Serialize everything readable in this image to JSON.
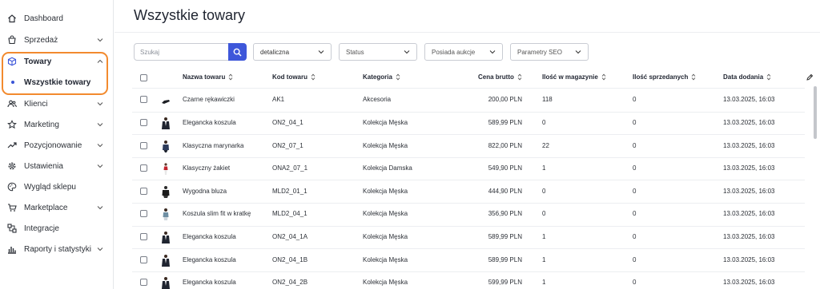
{
  "sidebar": {
    "items": [
      {
        "label": "Dashboard",
        "icon": "home-icon",
        "has_chevron": false
      },
      {
        "label": "Sprzedaż",
        "icon": "cart-icon",
        "has_chevron": true
      },
      {
        "label": "Towary",
        "icon": "box-icon",
        "has_chevron": true,
        "expanded": true,
        "active": true
      },
      {
        "label": "Klienci",
        "icon": "users-icon",
        "has_chevron": true
      },
      {
        "label": "Marketing",
        "icon": "star-icon",
        "has_chevron": true
      },
      {
        "label": "Pozycjonowanie",
        "icon": "trend-icon",
        "has_chevron": true
      },
      {
        "label": "Ustawienia",
        "icon": "gear-icon",
        "has_chevron": true
      },
      {
        "label": "Wygląd sklepu",
        "icon": "palette-icon",
        "has_chevron": false
      },
      {
        "label": "Marketplace",
        "icon": "marketplace-cart-icon",
        "has_chevron": true
      },
      {
        "label": "Integracje",
        "icon": "integrations-icon",
        "has_chevron": false
      },
      {
        "label": "Raporty i statystyki",
        "icon": "bar-chart-icon",
        "has_chevron": true
      }
    ],
    "sub_item": {
      "label": "Wszystkie towary"
    },
    "highlight_color": "#f28a2e"
  },
  "page": {
    "title": "Wszystkie towary"
  },
  "filters": {
    "search_placeholder": "Szukaj",
    "price_type": "detaliczna",
    "status": "Status",
    "auction": "Posiada aukcje",
    "seo": "Parametry SEO",
    "accent_color": "#3e57da"
  },
  "table": {
    "headers": {
      "name": "Nazwa towaru",
      "code": "Kod towaru",
      "category": "Kategoria",
      "price": "Cena brutto",
      "stock": "Ilość w magazynie",
      "sold": "Ilość sprzedanych",
      "date": "Data dodania"
    },
    "rows": [
      {
        "thumb": "gloves",
        "name": "Czarne rękawiczki",
        "code": "AK1",
        "category": "Akcesoria",
        "price": "200,00 PLN",
        "stock": "118",
        "sold": "0",
        "date": "13.03.2025, 16:03"
      },
      {
        "thumb": "shirt",
        "name": "Elegancka koszula",
        "code": "ON2_04_1",
        "category": "Kolekcja Męska",
        "price": "589,99 PLN",
        "stock": "0",
        "sold": "0",
        "date": "13.03.2025, 16:03"
      },
      {
        "thumb": "jacket",
        "name": "Klasyczna marynarka",
        "code": "ON2_07_1",
        "category": "Kolekcja Męska",
        "price": "822,00 PLN",
        "stock": "22",
        "sold": "0",
        "date": "13.03.2025, 16:03"
      },
      {
        "thumb": "woman-jacket",
        "name": "Klasyczny żakiet",
        "code": "ONA2_07_1",
        "category": "Kolekcja Damska",
        "price": "549,90 PLN",
        "stock": "1",
        "sold": "0",
        "date": "13.03.2025, 16:03"
      },
      {
        "thumb": "hoodie",
        "name": "Wygodna bluza",
        "code": "MLD2_01_1",
        "category": "Kolekcja Męska",
        "price": "444,90 PLN",
        "stock": "0",
        "sold": "0",
        "date": "13.03.2025, 16:03"
      },
      {
        "thumb": "check-shirt",
        "name": "Koszula slim fit w kratkę",
        "code": "MLD2_04_1",
        "category": "Kolekcja Męska",
        "price": "356,90 PLN",
        "stock": "0",
        "sold": "0",
        "date": "13.03.2025, 16:03"
      },
      {
        "thumb": "shirt",
        "name": "Elegancka koszula",
        "code": "ON2_04_1A",
        "category": "Kolekcja Męska",
        "price": "589,99 PLN",
        "stock": "1",
        "sold": "0",
        "date": "13.03.2025, 16:03"
      },
      {
        "thumb": "shirt",
        "name": "Elegancka koszula",
        "code": "ON2_04_1B",
        "category": "Kolekcja Męska",
        "price": "589,99 PLN",
        "stock": "1",
        "sold": "0",
        "date": "13.03.2025, 16:03"
      },
      {
        "thumb": "shirt",
        "name": "Elegancka koszula",
        "code": "ON2_04_2B",
        "category": "Kolekcja Męska",
        "price": "599,99 PLN",
        "stock": "1",
        "sold": "0",
        "date": "13.03.2025, 16:03"
      }
    ]
  }
}
